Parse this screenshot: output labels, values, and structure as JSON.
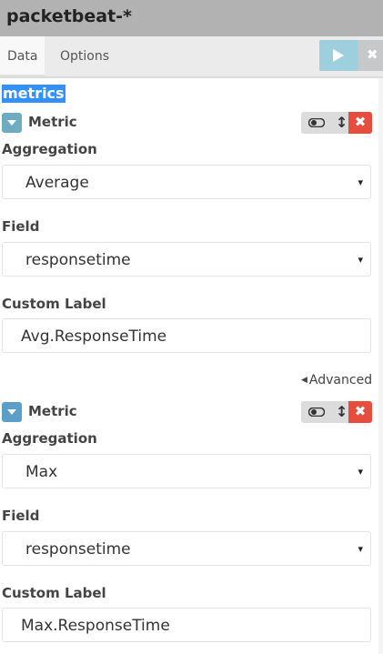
{
  "window": {
    "title": "packetbeat-*"
  },
  "tabs": [
    {
      "label": "Data",
      "active": true
    },
    {
      "label": "Options",
      "active": false
    }
  ],
  "toolbar": {
    "apply_icon": "play-icon",
    "discard_icon": "close-icon",
    "apply_color": "#9dd0dc"
  },
  "section": {
    "title": "metrics",
    "highlight_color": "#3390ff"
  },
  "metrics": [
    {
      "label": "Metric",
      "aggregation_label": "Aggregation",
      "aggregation_value": "Average",
      "field_label": "Field",
      "field_value": "responsetime",
      "custom_label_label": "Custom Label",
      "custom_label_value": "Avg.ResponseTime",
      "advanced_label": "Advanced"
    },
    {
      "label": "Metric",
      "aggregation_label": "Aggregation",
      "aggregation_value": "Max",
      "field_label": "Field",
      "field_value": "responsetime",
      "custom_label_label": "Custom Label",
      "custom_label_value": "Max.ResponseTime"
    }
  ],
  "icons": {
    "caret": "▾",
    "sort": "↕",
    "remove": "✖",
    "advanced_arrow": "◀"
  },
  "colors": {
    "remove": "#e74c3c",
    "toggle": "#6eadc1"
  }
}
